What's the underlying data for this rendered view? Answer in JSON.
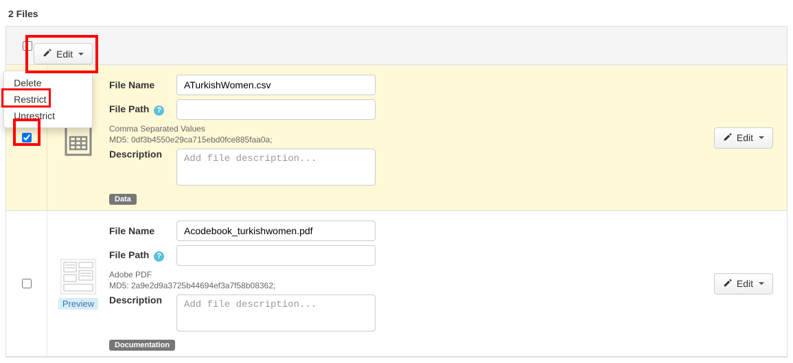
{
  "page": {
    "title": "2 Files"
  },
  "header": {
    "edit_label": "Edit",
    "menu": {
      "delete": "Delete",
      "restrict": "Restrict",
      "unrestrict": "Unrestrict"
    }
  },
  "labels": {
    "file_name": "File Name",
    "file_path": "File Path",
    "description": "Description",
    "edit": "Edit",
    "preview": "Preview",
    "desc_placeholder": "Add file description..."
  },
  "files": [
    {
      "selected": true,
      "name": "ATurkishWomen.csv",
      "path": "",
      "format": "Comma Separated Values",
      "md5": "MD5: 0df3b4550e29ca715ebd0fce885faa0a;",
      "description": "",
      "tag": "Data",
      "thumb": "spreadsheet",
      "has_preview": false
    },
    {
      "selected": false,
      "name": "Acodebook_turkishwomen.pdf",
      "path": "",
      "format": "Adobe PDF",
      "md5": "MD5: 2a9e2d9a3725b44694ef3a7f58b08362;",
      "description": "",
      "tag": "Documentation",
      "thumb": "pdf",
      "has_preview": true
    }
  ]
}
